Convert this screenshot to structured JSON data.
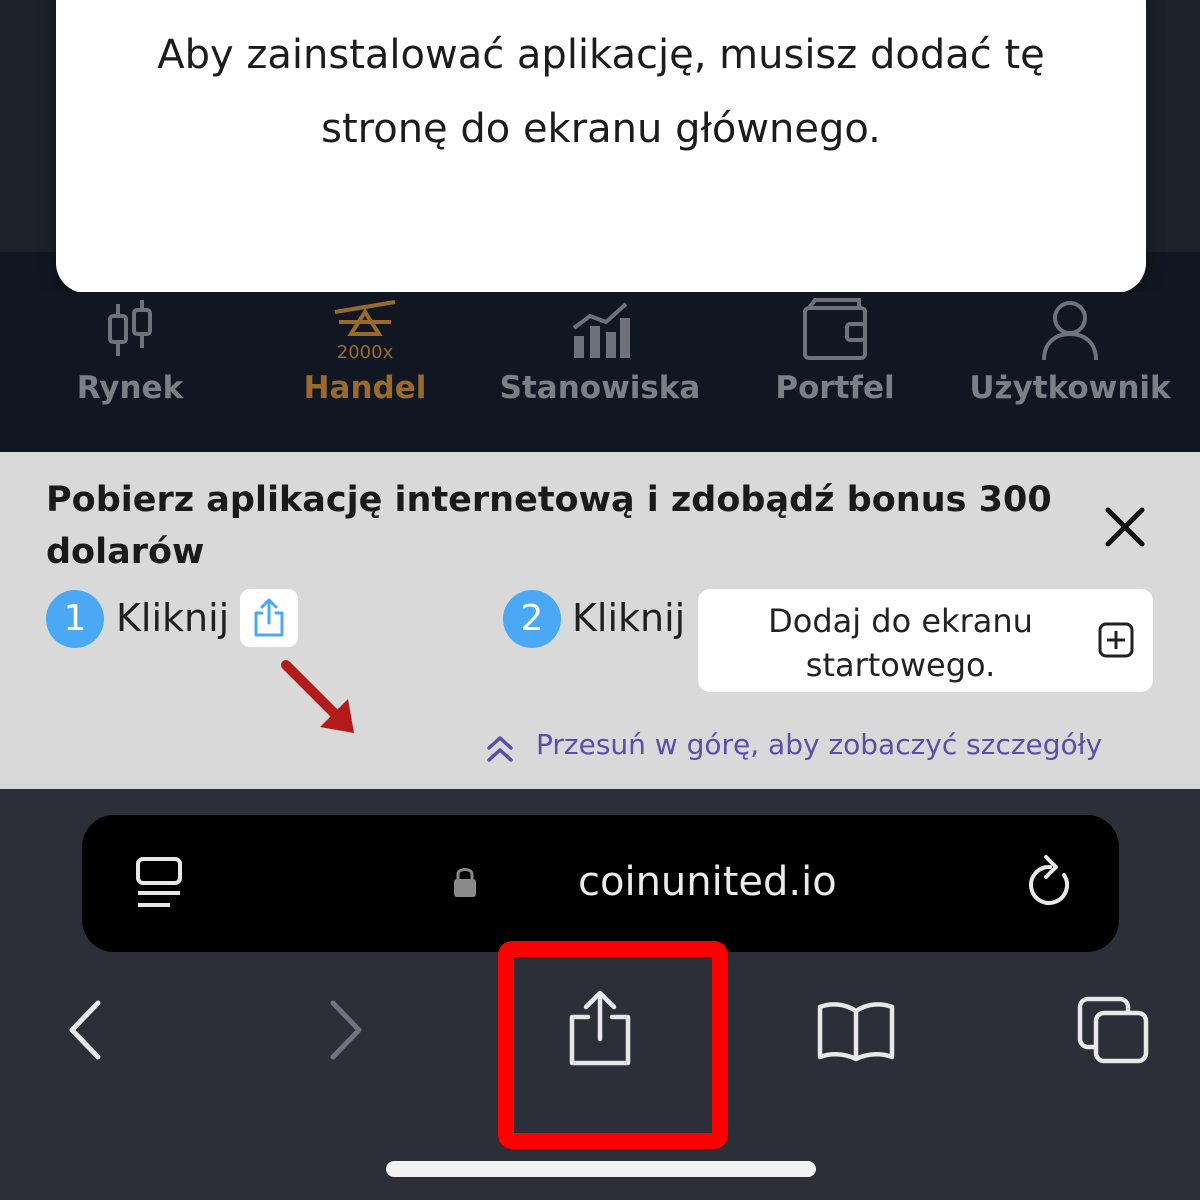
{
  "modal": {
    "message": "Aby zainstalować aplikację, musisz dodać tę stronę do ekranu głównego."
  },
  "tabbar": {
    "tabs": [
      {
        "label": "Rynek",
        "icon": "candlestick-icon"
      },
      {
        "label": "Handel",
        "icon": "leverage-icon",
        "badge": "2000x",
        "active": true
      },
      {
        "label": "Stanowiska",
        "icon": "bar-chart-trend-icon"
      },
      {
        "label": "Portfel",
        "icon": "wallet-icon"
      },
      {
        "label": "Użytkownik",
        "icon": "user-icon"
      }
    ]
  },
  "banner": {
    "title": "Pobierz aplikację internetową i zdobądź bonus 300 dolarów",
    "step1_number": "1",
    "step1_text": "Kliknij",
    "step2_number": "2",
    "step2_text": "Kliknij",
    "add_to_home_label": "Dodaj do ekranu startowego.",
    "swipe_hint": "Przesuń w górę, aby zobaczyć szczegóły",
    "accent_color": "#4aa8f5",
    "hint_color": "#5b4ea6"
  },
  "browser": {
    "url": "coinunited.io",
    "highlight_color": "#ff0000"
  }
}
